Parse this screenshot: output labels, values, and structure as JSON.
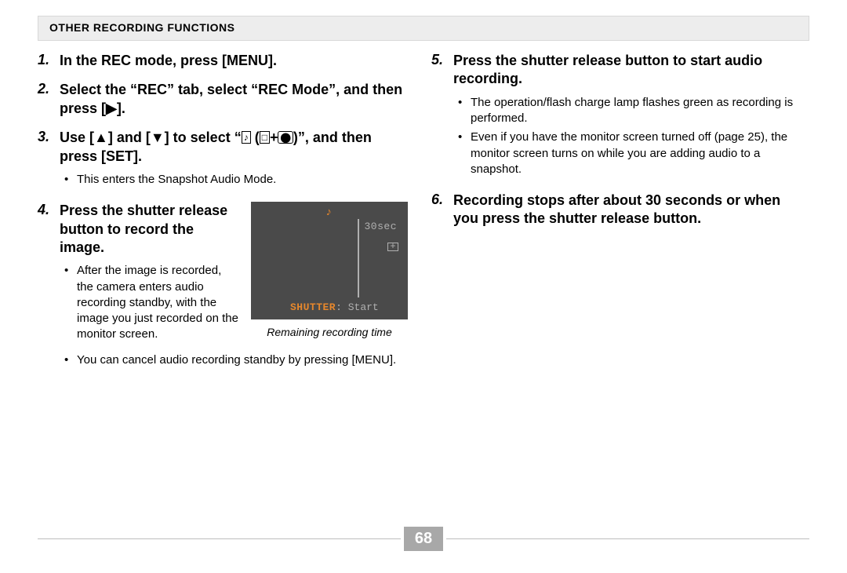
{
  "header": {
    "title": "Other Recording Functions"
  },
  "page_number": "68",
  "left": {
    "step1": {
      "num": "1.",
      "title": "In the REC mode, press [MENU]."
    },
    "step2": {
      "num": "2.",
      "title_a": "Select the “REC” tab, select “REC Mode”, and then press [",
      "title_b": "]."
    },
    "step3": {
      "num": "3.",
      "title_a": "Use [",
      "title_b": "] and [",
      "title_c": "] to select “",
      "icon1": "♪",
      "paren_open": "(",
      "icon2": "□",
      "plus": "+",
      "icon3": "⬤",
      "title_d": ")”, and then press [SET].",
      "bullet1": "This enters the Snapshot Audio Mode."
    },
    "step4": {
      "num": "4.",
      "title": "Press the shutter release button to record the image.",
      "bullet1": "After the image is recorded, the camera enters audio recording standby, with the image you just recorded on the monitor screen.",
      "bullet2": "You can cancel audio recording standby by pressing [MENU].",
      "lcd": {
        "timer": "30sec",
        "shutter": "SHUTTER",
        "start": ": Start"
      },
      "caption": "Remaining recording time"
    }
  },
  "right": {
    "step5": {
      "num": "5.",
      "title": "Press the shutter release button to start audio recording.",
      "bullet1": "The operation/flash charge lamp flashes green as recording is performed.",
      "bullet2": "Even if you have the monitor screen turned off (page 25), the monitor screen turns on while you are adding audio to a snapshot."
    },
    "step6": {
      "num": "6.",
      "title": "Recording stops after about 30 seconds or when you press the shutter release button."
    }
  }
}
